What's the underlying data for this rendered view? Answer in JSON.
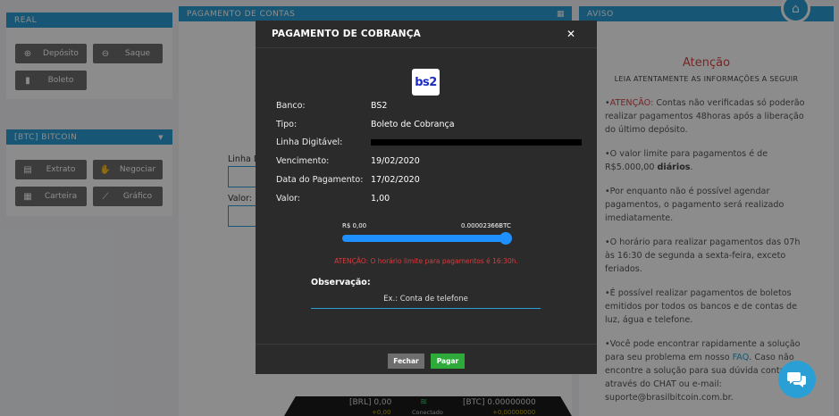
{
  "left_panel": {
    "real": {
      "title": "REAL",
      "buttons": [
        {
          "label": "Depósito",
          "icon": "plus-circle-icon"
        },
        {
          "label": "Saque",
          "icon": "minus-circle-icon"
        },
        {
          "label": "Boleto",
          "icon": "file-icon"
        }
      ]
    },
    "bitcoin": {
      "title": "[BTC] BITCOIN",
      "buttons": [
        {
          "label": "Extrato",
          "icon": "file-text-icon"
        },
        {
          "label": "Negociar",
          "icon": "handshake-icon"
        },
        {
          "label": "Carteira",
          "icon": "qrcode-icon"
        },
        {
          "label": "Gráfico",
          "icon": "line-chart-icon"
        }
      ]
    }
  },
  "middle_panel": {
    "title": "PAGAMENTO DE CONTAS",
    "linha_label": "Linha D",
    "valor_label": "Valor:"
  },
  "right_panel": {
    "title": "AVISO",
    "heading": "Atenção",
    "subheading": "LEIA ATENTAMENTE AS INFORMAÇÕES A SEGUIR",
    "items": {
      "i1_red": "ATENÇÃO:",
      "i1_rest": " Contas não verificadas só poderão realizar pagamentos 48horas após a liberação do último depósito.",
      "i2_text": "O valor limite para pagamentos é de R$5.000,00 ",
      "i2_bold": "diários",
      "i2_end": ".",
      "i3": "Por enquanto não é possível agendar pagamentos, o pagamento será realizado imediatamente.",
      "i4": "O horário para realizar pagamentos das 07h às 16:30 de segunda a sexta-feira, exceto feriados.",
      "i5": "É possível realizar pagamentos de boletos emitidos por todos os bancos e de contas de luz, água e telefone.",
      "i6_a": "Você pode encontrar rapidamente a solução para seu problema em nosso ",
      "i6_link": "FAQ",
      "i6_b": ". Caso não encontre a solução para sua dúvida contate através do CHAT ou e-mail: suporte@brasilbitcoin.com.br."
    }
  },
  "statusbar": {
    "brl": "[BRL] 0,00",
    "brl_delta": "+0,00",
    "btc": "[BTC] 0.00000000",
    "btc_delta": "+0,00000000",
    "connection": "Conectado"
  },
  "modal": {
    "title": "PAGAMENTO DE COBRANÇA",
    "bank_logo_text": "bs2",
    "fields": {
      "banco_label": "Banco:",
      "banco_value": "BS2",
      "tipo_label": "Tipo:",
      "tipo_value": "Boleto de Cobrança",
      "linha_label": "Linha Digitável:",
      "vencimento_label": "Vencimento:",
      "vencimento_value": "19/02/2020",
      "data_label": "Data do Pagamento:",
      "data_value": "17/02/2020",
      "valor_label": "Valor:",
      "valor_value": "1,00"
    },
    "slider": {
      "min_label": "R$ 0,00",
      "max_label": "0.00002366BTC",
      "fraction": 0.95
    },
    "warning": "ATENÇÃO: O horário limite para pagamentos é 16:30h.",
    "observacao_label": "Observação:",
    "observacao_placeholder": "Ex.: Conta de telefone",
    "fechar_label": "Fechar",
    "pagar_label": "Pagar"
  },
  "colors": {
    "accent": "#2a9fd6",
    "pay": "#2eaa3a",
    "warn": "#d63c3c",
    "modal_bg": "#2b2b2b"
  }
}
